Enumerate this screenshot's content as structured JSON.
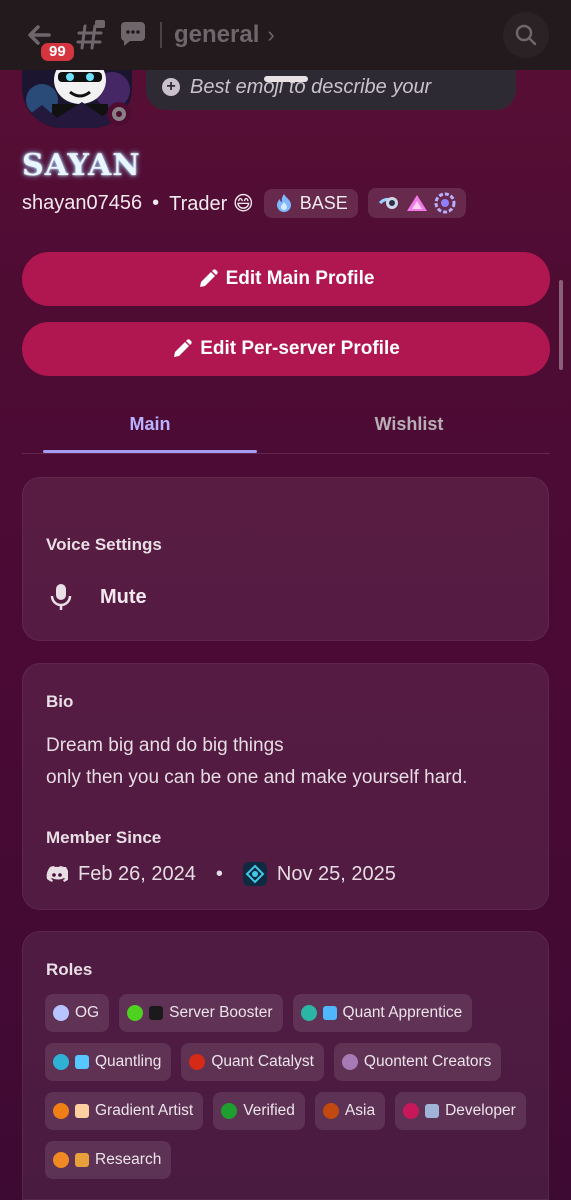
{
  "header": {
    "unread_count": "99",
    "channel_name": "general",
    "chevron": "›"
  },
  "profile": {
    "emoji_status_placeholder": "Best emoji to describe your",
    "display_name": "SAYAN",
    "username": "shayan07456",
    "separator": "•",
    "pronouns": "Trader 😄",
    "clan_tag": "BASE",
    "badges": [
      "boost-badge",
      "triangle-badge",
      "laurel-badge"
    ]
  },
  "actions": {
    "edit_main": "Edit Main Profile",
    "edit_server": "Edit Per-server Profile"
  },
  "tabs": [
    {
      "label": "Main",
      "active": true
    },
    {
      "label": "Wishlist",
      "active": false
    }
  ],
  "voice": {
    "heading": "Voice Settings",
    "mute_label": "Mute"
  },
  "bio": {
    "heading": "Bio",
    "line1": "Dream big and do big things",
    "line2": "only then you can be one and make yourself hard.",
    "member_since_heading": "Member Since",
    "discord_date": "Feb 26, 2024",
    "separator": "•",
    "server_date": "Nov 25, 2025"
  },
  "roles": {
    "heading": "Roles",
    "items": [
      {
        "label": "OG",
        "color": "#b7c4ff",
        "icon": ""
      },
      {
        "label": "Server Booster",
        "color": "#4fd11f",
        "icon": "booster-icon"
      },
      {
        "label": "Quant Apprentice",
        "color": "#2bb5a4",
        "icon": "apprentice-icon"
      },
      {
        "label": "Quantling",
        "color": "#2fb1d6",
        "icon": "quantling-icon"
      },
      {
        "label": "Quant Catalyst",
        "color": "#d42a16",
        "icon": ""
      },
      {
        "label": "Quontent Creators",
        "color": "#a77ab6",
        "icon": ""
      },
      {
        "label": "Gradient Artist",
        "color": "#f07f16",
        "icon": "palette-icon"
      },
      {
        "label": "Verified",
        "color": "#1e9e2e",
        "icon": ""
      },
      {
        "label": "Asia",
        "color": "#c24a10",
        "icon": ""
      },
      {
        "label": "Developer",
        "color": "#c8185a",
        "icon": "laptop-icon"
      },
      {
        "label": "Research",
        "color": "#f08a24",
        "icon": "book-icon"
      }
    ]
  },
  "colors": {
    "accent_button": "#b0164f",
    "tab_active": "#b9b3ff",
    "background": "#4e0c33"
  }
}
